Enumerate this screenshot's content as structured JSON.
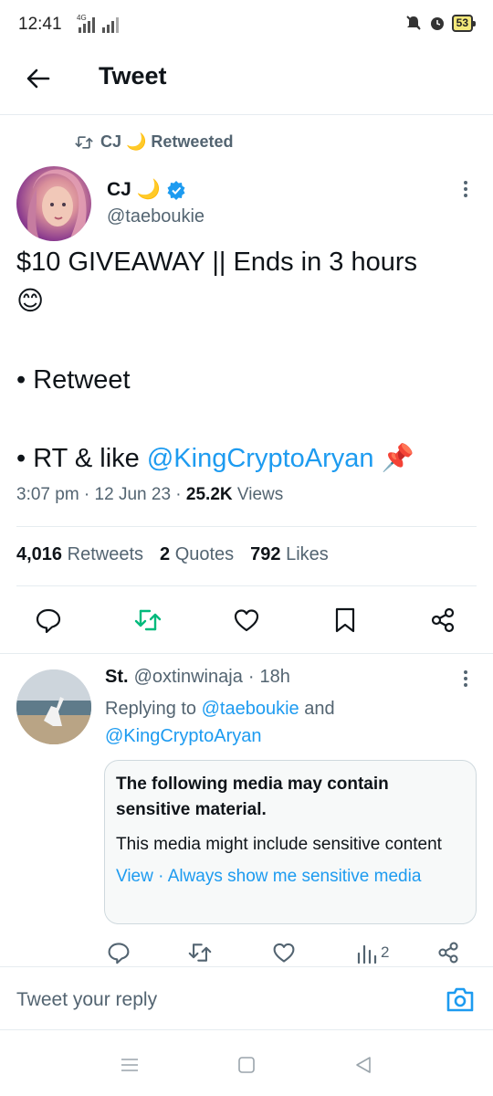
{
  "status_bar": {
    "time": "12:41",
    "network": "4G",
    "battery": "53",
    "icons": [
      "signal-icon",
      "mute-icon",
      "alarm-icon",
      "battery-icon"
    ]
  },
  "header": {
    "title": "Tweet",
    "back_icon": "back-arrow-icon"
  },
  "tweet": {
    "retweeted_by": "CJ 🌙 Retweeted",
    "author_name": "CJ 🌙",
    "author_handle": "@taeboukie",
    "verified": true,
    "text_lines": [
      "$10 GIVEAWAY || Ends in 3 hours",
      "😊",
      "",
      "• Retweet",
      "",
      "• RT & like "
    ],
    "mention": "@KingCryptoAryan",
    "pin_emoji": "📌",
    "time": "3:07 pm",
    "date": "12 Jun 23",
    "views_count": "25.2K",
    "views_label": "Views",
    "retweets_count": "4,016",
    "retweets_label": "Retweets",
    "quotes_count": "2",
    "quotes_label": "Quotes",
    "likes_count": "792",
    "likes_label": "Likes"
  },
  "reply": {
    "author_name": "St.",
    "author_handle": "@oxtinwinaja",
    "age": "18h",
    "replying_prefix": "Replying to ",
    "replying_to_1": "@taeboukie",
    "replying_and": " and",
    "replying_to_2": "@KingCryptoAryan",
    "sensitive_title": "The following media may contain sensitive material.",
    "sensitive_body": "This media might include sensitive content",
    "view_link": "View",
    "link_separator": " · ",
    "always_show_link": "Always show me sensitive media",
    "views": "2"
  },
  "compose": {
    "placeholder": "Tweet your reply"
  },
  "colors": {
    "accent": "#1d9bf0",
    "retweet_active": "#00ba7c",
    "secondary_text": "#536471"
  }
}
